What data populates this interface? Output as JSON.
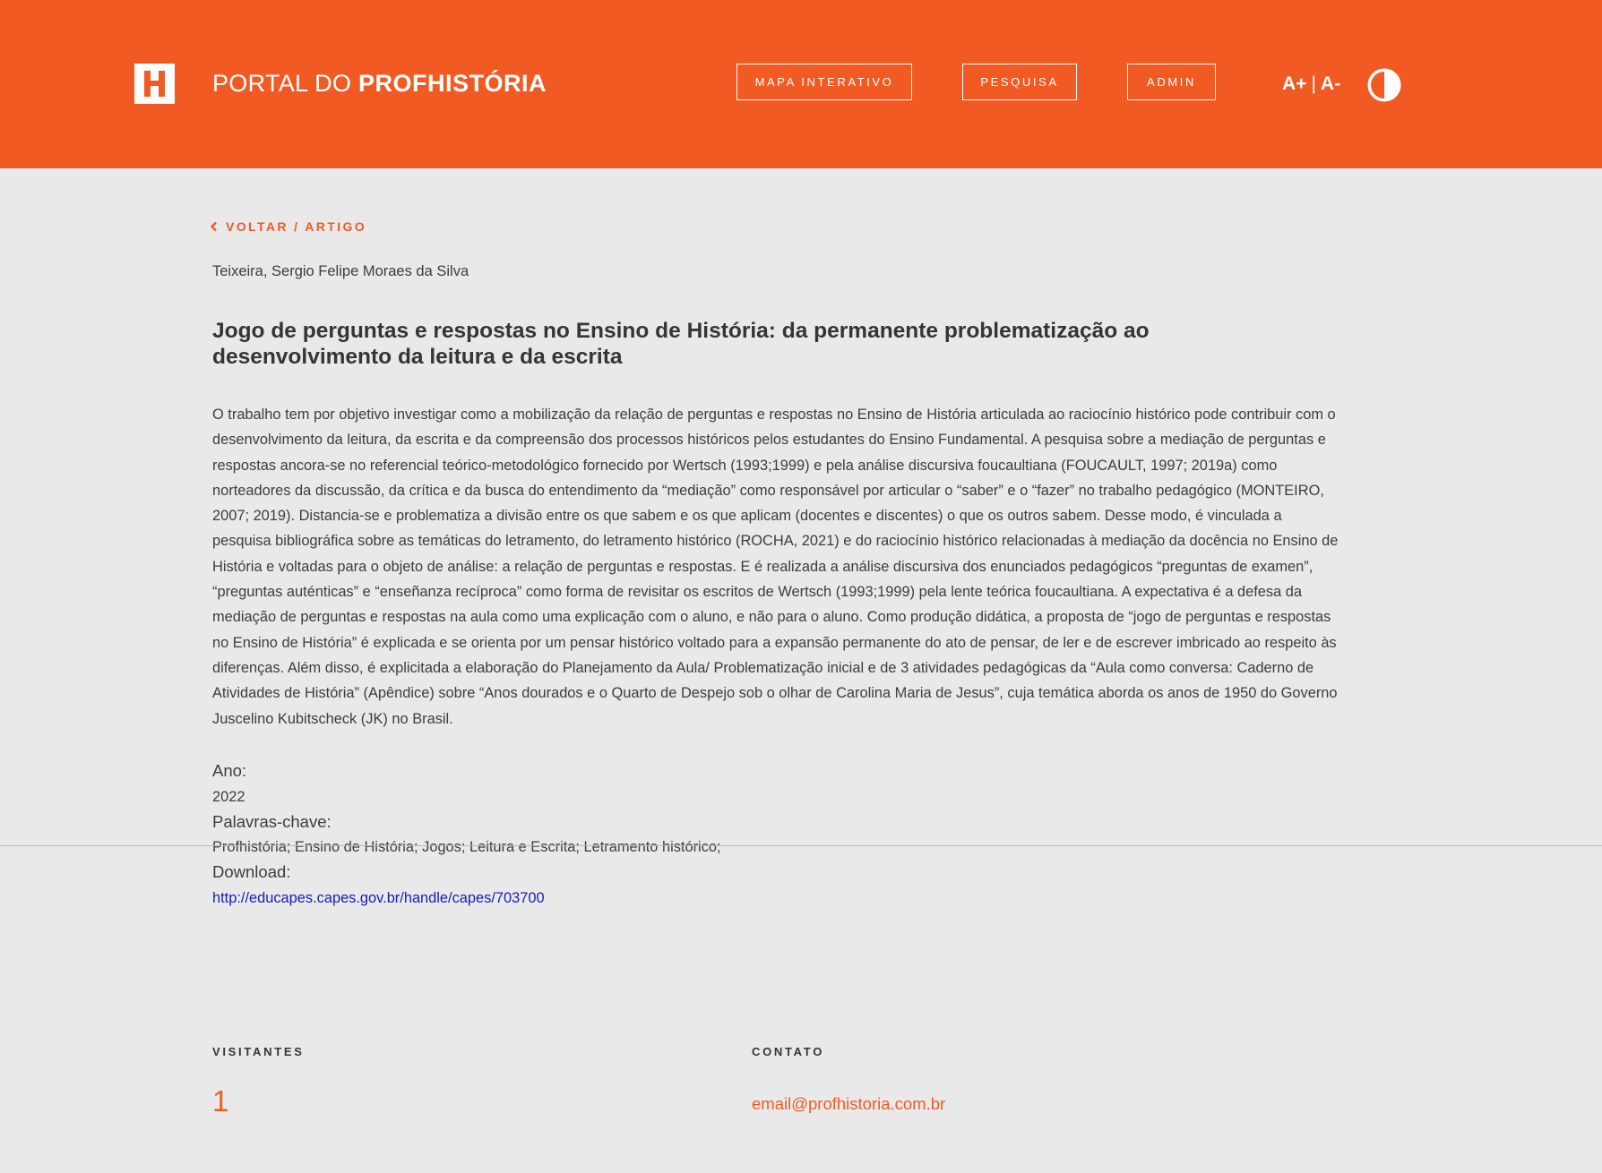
{
  "header": {
    "logo_letter": "H",
    "logo_text_light": "PORTAL DO ",
    "logo_text_bold": "PROFHISTÓRIA",
    "nav": [
      {
        "label": "MAPA INTERATIVO"
      },
      {
        "label": "PESQUISA"
      },
      {
        "label": "ADMIN"
      }
    ],
    "font_increase": "A+",
    "font_separator": "|",
    "font_decrease": "A-",
    "contrast_icon": "contrast-icon",
    "background_color": "#f25a23"
  },
  "back_link": {
    "label": "VOLTAR / ARTIGO",
    "icon": "chevron-left-icon"
  },
  "article": {
    "author": "Teixeira, Sergio Felipe Moraes da Silva",
    "title": "Jogo de perguntas e respostas no Ensino de História: da permanente problematização ao desenvolvimento da leitura e da escrita",
    "abstract": "O trabalho tem por objetivo investigar como a mobilização da relação de perguntas e respostas no Ensino de História articulada ao raciocínio histórico pode contribuir com o desenvolvimento da leitura, da escrita e da compreensão dos processos históricos pelos estudantes do Ensino Fundamental. A pesquisa sobre a mediação de perguntas e respostas ancora-se no referencial teórico-metodológico fornecido por Wertsch (1993;1999) e pela análise discursiva foucaultiana (FOUCAULT, 1997; 2019a) como norteadores da discussão, da crítica e da busca do entendimento da “mediação” como responsável por articular o “saber” e o “fazer” no trabalho pedagógico (MONTEIRO, 2007; 2019). Distancia-se e problematiza a divisão entre os que sabem e os que aplicam (docentes e discentes) o que os outros sabem. Desse modo, é vinculada a pesquisa bibliográfica sobre as temáticas do letramento, do letramento histórico (ROCHA, 2021) e do raciocínio histórico relacionadas à mediação da docência no Ensino de História e voltadas para o objeto de análise: a relação de perguntas e respostas. E é realizada a análise discursiva dos enunciados pedagógicos “preguntas de examen”, “preguntas auténticas” e “enseñanza recíproca” como forma de revisitar os escritos de Wertsch (1993;1999) pela lente teórica foucaultiana. A expectativa é a defesa da mediação de perguntas e respostas na aula como uma explicação com o aluno, e não para o aluno. Como produção didática, a proposta de “jogo de perguntas e respostas no Ensino de História” é explicada e se orienta por um pensar histórico voltado para a expansão permanente do ato de pensar, de ler e de escrever imbricado ao respeito às diferenças. Além disso, é explicitada a elaboração do Planejamento da Aula/ Problematização inicial e de 3 atividades pedagógicas da “Aula como conversa: Caderno de Atividades de História” (Apêndice) sobre “Anos dourados e o Quarto de Despejo sob o olhar de Carolina Maria de Jesus”, cuja temática aborda os anos de 1950 do Governo Juscelino Kubitscheck (JK) no Brasil.",
    "year_label": "Ano:",
    "year_value": "2022",
    "keywords_label": "Palavras-chave:",
    "keywords_value": "Profhistória; Ensino de História; Jogos; Leitura e Escrita; Letramento histórico;",
    "download_label": "Download:",
    "download_url": "http://educapes.capes.gov.br/handle/capes/703700"
  },
  "footer": {
    "visitors_heading": "VISITANTES",
    "visitors_count": "1",
    "contact_heading": "CONTATO",
    "contact_email": "email@profhistoria.com.br"
  },
  "colors": {
    "accent": "#f25a23",
    "page_background": "#e9e9ea",
    "text": "#3d3d3d",
    "link": "#1b1bb5"
  }
}
